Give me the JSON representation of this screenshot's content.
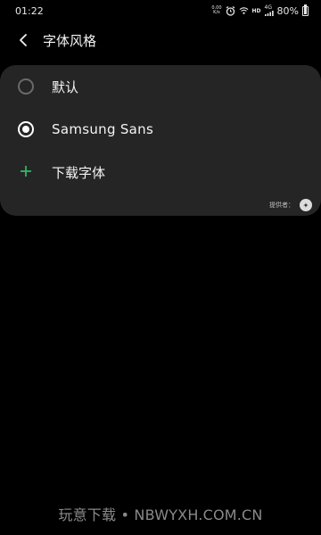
{
  "status_bar": {
    "time": "01:22",
    "net_speed_top": "0.00",
    "net_speed_bottom": "K/s",
    "hd_label": "HD",
    "signal_4g": "4G",
    "battery_percent": "80%",
    "battery_level": 0.8
  },
  "header": {
    "back_icon": "chevron-left-icon",
    "title": "字体风格"
  },
  "font_options": [
    {
      "label": "默认",
      "selected": false,
      "icon": "radio-icon"
    },
    {
      "label": "Samsung Sans",
      "selected": true,
      "icon": "radio-icon"
    }
  ],
  "download": {
    "label": "下载字体",
    "icon": "plus-icon"
  },
  "provider": {
    "label": "提供者：",
    "logo_icon": "provider-logo-icon"
  },
  "watermark": {
    "text": "玩意下载 • NBWYXH.COM.CN"
  },
  "colors": {
    "background": "#000000",
    "card": "#252525",
    "accent_plus": "#2fb865"
  }
}
